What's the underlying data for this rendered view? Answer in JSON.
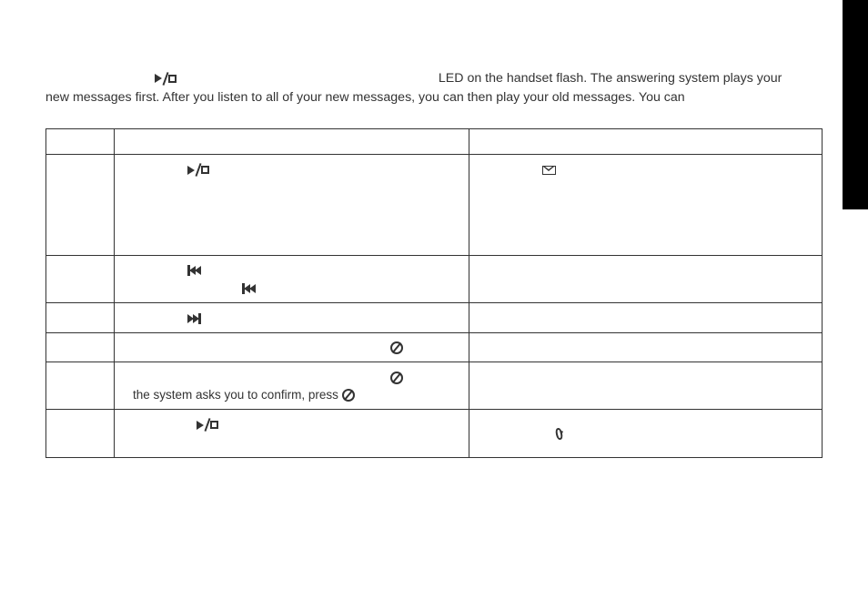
{
  "intro": {
    "line1_mid": " LED on the handset flash. The answering system plays your",
    "line2": "new messages first. After you listen to all of your new messages, you can then play your old messages. You can"
  },
  "table": {
    "rows": [
      {
        "col2": "the system asks you to confirm, press "
      }
    ]
  }
}
